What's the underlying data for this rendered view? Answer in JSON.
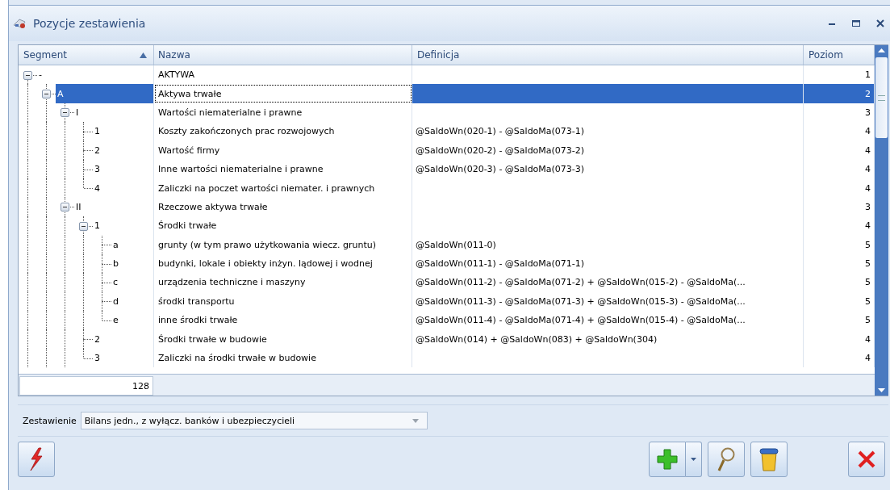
{
  "window": {
    "title": "Pozycje zestawienia"
  },
  "table": {
    "columns": [
      {
        "label": "Segment",
        "sorted": true
      },
      {
        "label": "Nazwa",
        "sorted": false
      },
      {
        "label": "Definicja",
        "sorted": false
      },
      {
        "label": "Poziom",
        "sorted": false
      }
    ],
    "rows": [
      {
        "segment": "-",
        "name": "AKTYWA",
        "level": "1",
        "selected": false,
        "expanded": true,
        "children": [
          {
            "segment": "A",
            "name": "Aktywa trwałe",
            "level": "2",
            "selected": true,
            "expanded": true,
            "children": [
              {
                "segment": "I",
                "name": "Wartości niematerialne i prawne",
                "level": "3",
                "selected": false,
                "expanded": true,
                "children": [
                  {
                    "segment": "1",
                    "name": "Koszty zakończonych prac rozwojowych",
                    "definition": "@SaldoWn(020-1) - @SaldoMa(073-1)",
                    "level": "4",
                    "selected": false
                  },
                  {
                    "segment": "2",
                    "name": "Wartość firmy",
                    "definition": "@SaldoWn(020-2) - @SaldoMa(073-2)",
                    "level": "4",
                    "selected": false
                  },
                  {
                    "segment": "3",
                    "name": "Inne wartości niematerialne i prawne",
                    "definition": "@SaldoWn(020-3) - @SaldoMa(073-3)",
                    "level": "4",
                    "selected": false
                  },
                  {
                    "segment": "4",
                    "name": "Zaliczki na poczet wartości niemater. i prawnych",
                    "level": "4",
                    "selected": false
                  }
                ]
              },
              {
                "segment": "II",
                "name": "Rzeczowe aktywa trwałe",
                "level": "3",
                "selected": false,
                "expanded": true,
                "children": [
                  {
                    "segment": "1",
                    "name": "Środki trwałe",
                    "level": "4",
                    "selected": false,
                    "expanded": true,
                    "children": [
                      {
                        "segment": "a",
                        "name": "grunty (w tym prawo użytkowania wiecz. gruntu)",
                        "definition": "@SaldoWn(011-0)",
                        "level": "5",
                        "selected": false
                      },
                      {
                        "segment": "b",
                        "name": "budynki, lokale i obiekty inżyn. lądowej i wodnej",
                        "definition": "@SaldoWn(011-1) - @SaldoMa(071-1)",
                        "level": "5",
                        "selected": false
                      },
                      {
                        "segment": "c",
                        "name": "urządzenia techniczne i maszyny",
                        "definition": "@SaldoWn(011-2) - @SaldoMa(071-2) + @SaldoWn(015-2) - @SaldoMa(...",
                        "level": "5",
                        "selected": false
                      },
                      {
                        "segment": "d",
                        "name": "środki transportu",
                        "definition": "@SaldoWn(011-3) - @SaldoMa(071-3) + @SaldoWn(015-3) - @SaldoMa(...",
                        "level": "5",
                        "selected": false
                      },
                      {
                        "segment": "e",
                        "name": "inne środki trwałe",
                        "definition": "@SaldoWn(011-4) - @SaldoMa(071-4) + @SaldoWn(015-4) - @SaldoMa(...",
                        "level": "5",
                        "selected": false
                      }
                    ]
                  },
                  {
                    "segment": "2",
                    "name": "Środki trwałe w budowie",
                    "definition": "@SaldoWn(014) + @SaldoWn(083) + @SaldoWn(304)",
                    "level": "4",
                    "selected": false
                  },
                  {
                    "segment": "3",
                    "name": "Zaliczki na środki trwałe w budowie",
                    "level": "4",
                    "selected": false
                  }
                ]
              }
            ]
          }
        ]
      }
    ],
    "footer": {
      "count": "128"
    }
  },
  "filter": {
    "label": "Zestawienie",
    "value": "Bilans jedn., z wyłącz. banków i ubezpieczycieli"
  },
  "buttons": [
    {
      "kind": "run",
      "menu": false
    },
    {
      "kind": "add",
      "menu": true
    },
    {
      "kind": "view",
      "menu": false
    },
    {
      "kind": "delete",
      "menu": false
    },
    {
      "kind": "close",
      "menu": false
    }
  ]
}
